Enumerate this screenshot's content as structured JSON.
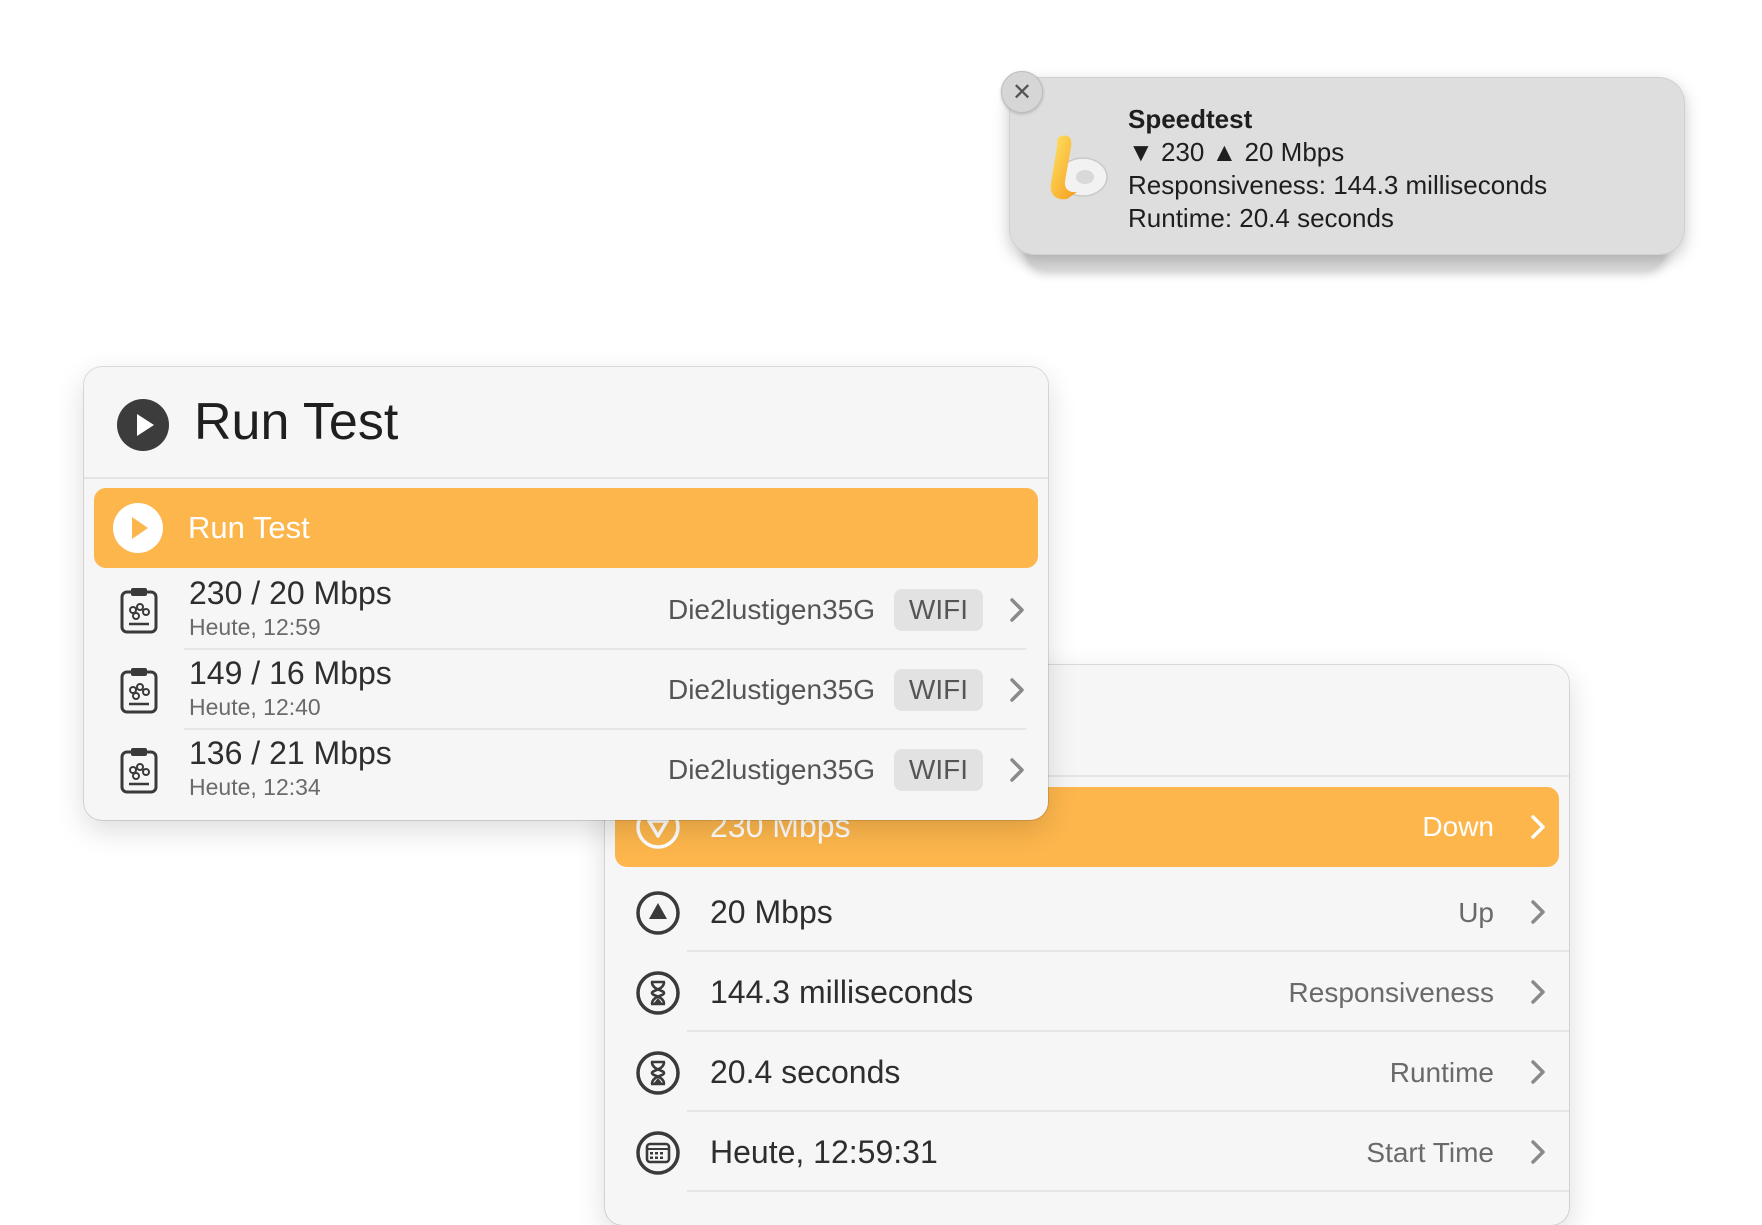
{
  "notification": {
    "title": "Speedtest",
    "speeds": "▼ 230 ▲ 20 Mbps",
    "responsiveness": "Responsiveness: 144.3 milliseconds",
    "runtime": "Runtime: 20.4 seconds",
    "close_glyph": "✕"
  },
  "run_panel": {
    "title": "Run Test",
    "selected_item": "Run Test",
    "history": [
      {
        "speeds": "230 / 20 Mbps",
        "time": "Heute, 12:59",
        "network": "Die2lustigen35G",
        "badge": "WIFI"
      },
      {
        "speeds": "149 / 16 Mbps",
        "time": "Heute, 12:40",
        "network": "Die2lustigen35G",
        "badge": "WIFI"
      },
      {
        "speeds": "136 / 21 Mbps",
        "time": "Heute, 12:34",
        "network": "Die2lustigen35G",
        "badge": "WIFI"
      }
    ]
  },
  "detail_panel": {
    "rows": [
      {
        "value": "230 Mbps",
        "label": "Down",
        "icon": "arrow-down-circle-icon"
      },
      {
        "value": "20 Mbps",
        "label": "Up",
        "icon": "arrow-up-circle-icon"
      },
      {
        "value": "144.3 milliseconds",
        "label": "Responsiveness",
        "icon": "hourglass-icon"
      },
      {
        "value": "20.4 seconds",
        "label": "Runtime",
        "icon": "hourglass-icon"
      },
      {
        "value": "Heute, 12:59:31",
        "label": "Start Time",
        "icon": "calendar-icon"
      }
    ]
  },
  "colors": {
    "accent": "#fdb64c",
    "panel": "#f6f6f6",
    "notification": "#dedede"
  }
}
